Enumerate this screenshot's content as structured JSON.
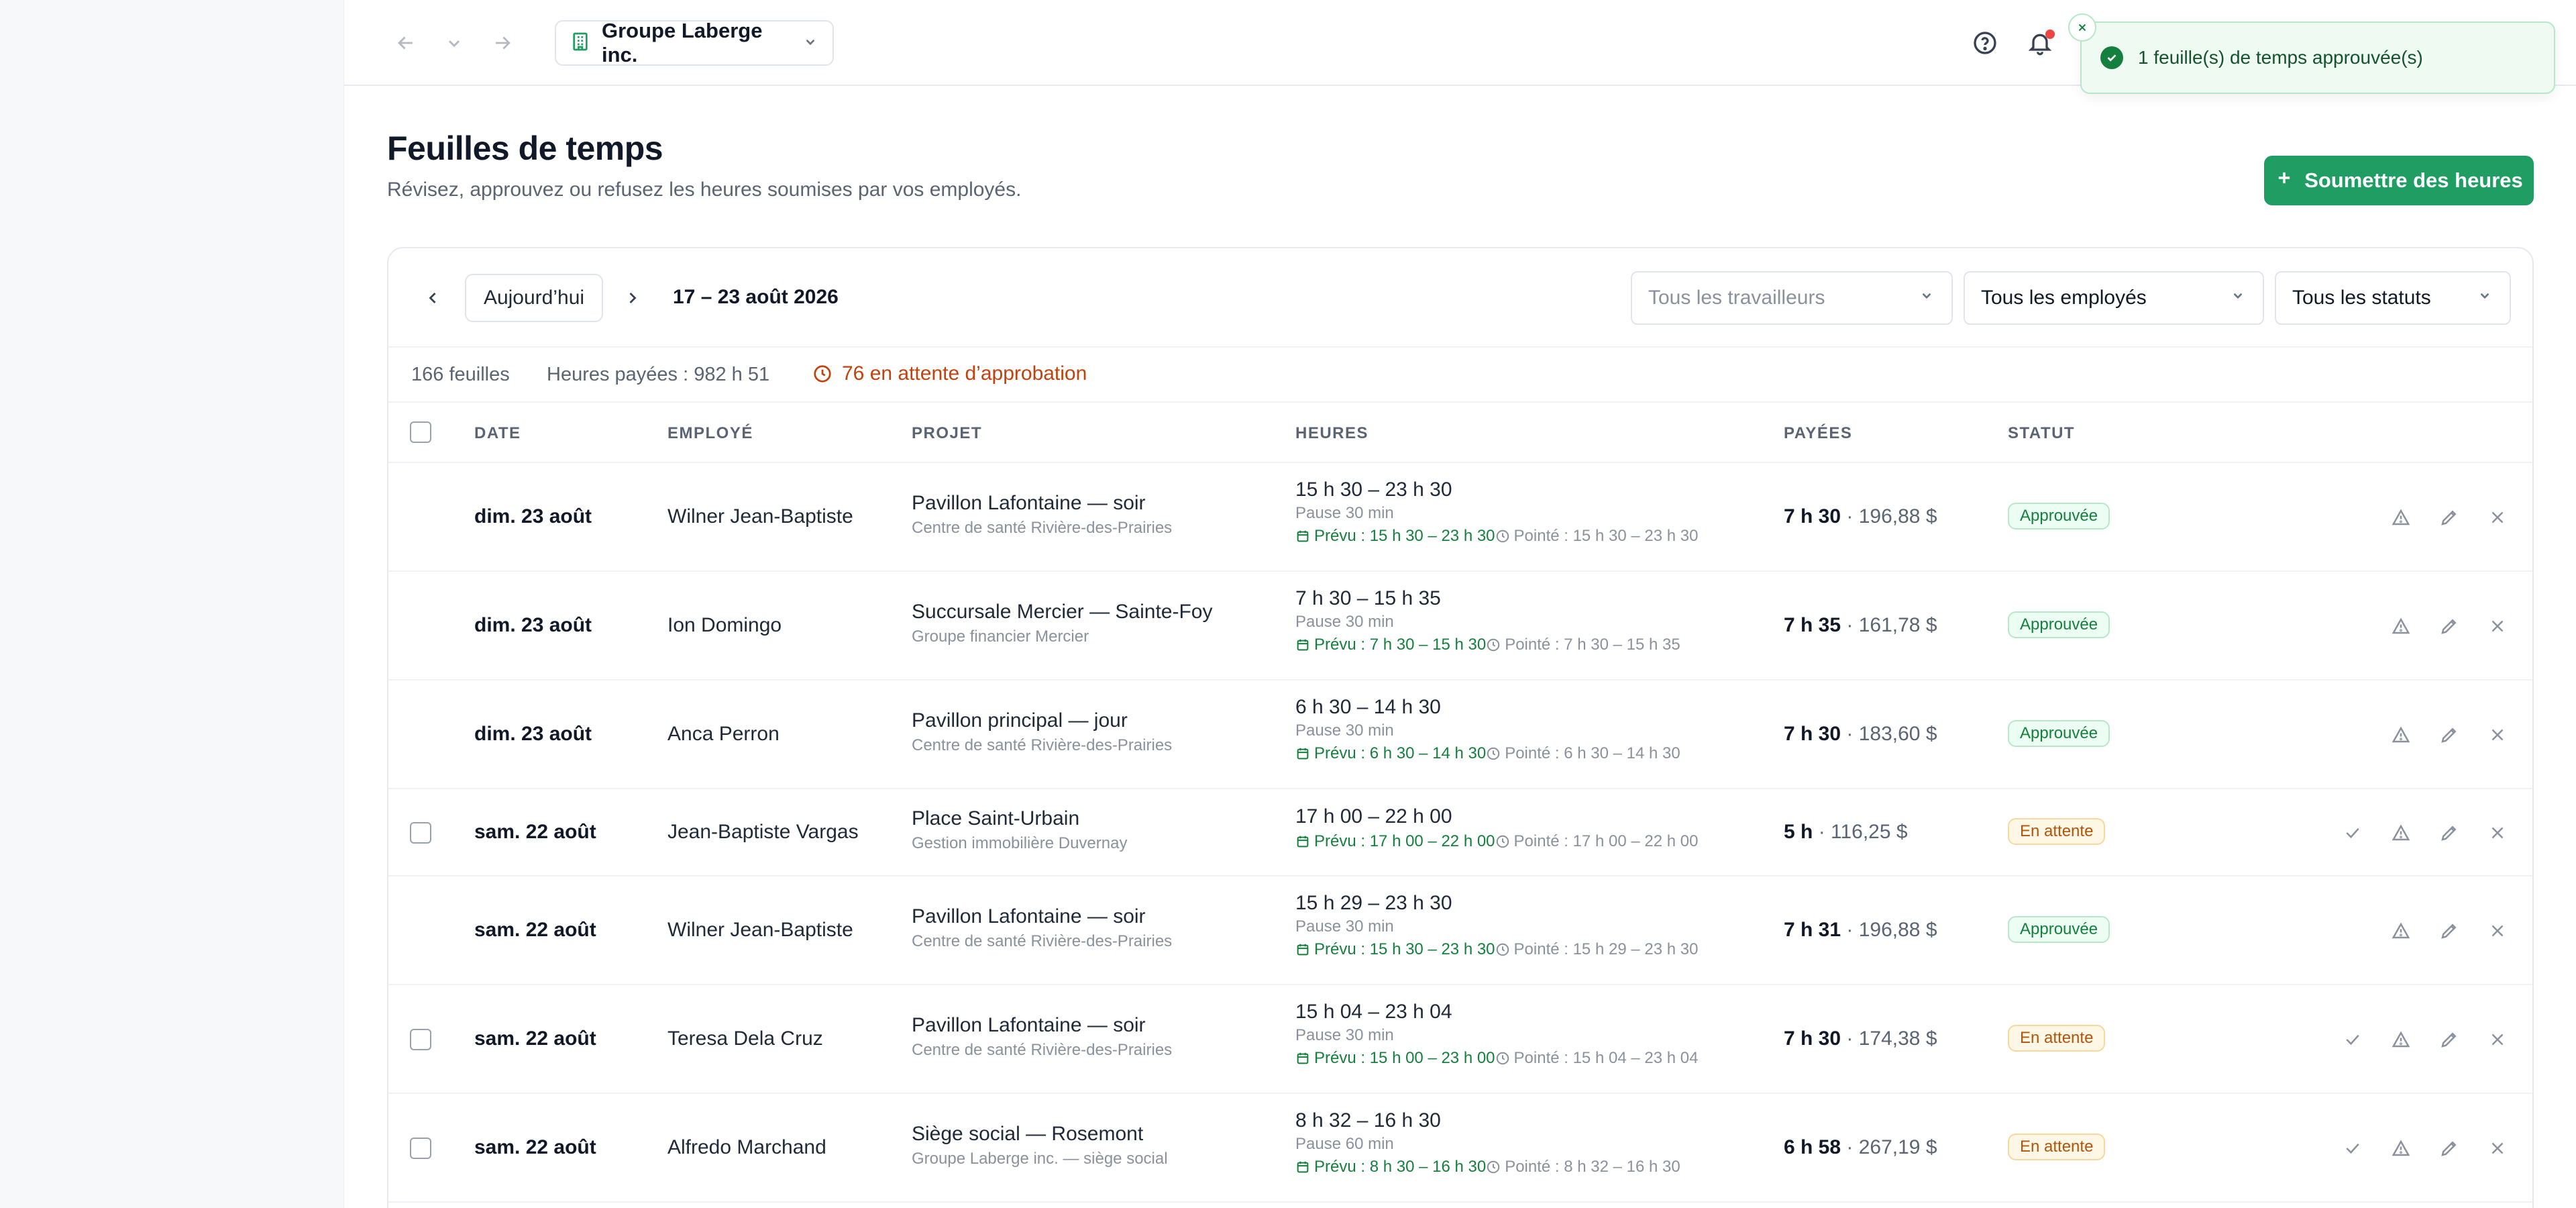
{
  "topbar": {
    "company": "Groupe Laberge inc."
  },
  "toast": {
    "message": "1 feuille(s) de temps approuvée(s)"
  },
  "header": {
    "title": "Feuilles de temps",
    "subtitle": "Révisez, approuvez ou refusez les heures soumises par vos employés.",
    "submit_label": "Soumettre des heures"
  },
  "toolbar": {
    "today_label": "Aujourd’hui",
    "week_range": "17 – 23 août 2026",
    "filters": {
      "workers_placeholder": "Tous les travailleurs",
      "employees_value": "Tous les employés",
      "status_value": "Tous les statuts"
    }
  },
  "summary": {
    "sheets": "166 feuilles",
    "paid_hours": "Heures payées : 982 h 51",
    "pending": "76 en attente d’approbation"
  },
  "table": {
    "headers": {
      "date": "DATE",
      "employee": "EMPLOYÉ",
      "project": "PROJET",
      "hours": "HEURES",
      "paid": "PAYÉES",
      "status": "STATUT"
    },
    "rows": [
      {
        "date": "dim. 23 août",
        "employee": "Wilner Jean-Baptiste",
        "project": "Pavillon Lafontaine — soir",
        "client": "Centre de santé Rivière-des-Prairies",
        "range": "15 h 30 – 23 h 30",
        "pause": "Pause 30 min",
        "planned": "Prévu : 15 h 30 – 23 h 30",
        "clocked": "Pointé : 15 h 30 – 23 h 30",
        "paid_hours": "7 h 30",
        "paid_amount": " · 196,88 $",
        "status": "Approuvée",
        "pending": false
      },
      {
        "date": "dim. 23 août",
        "employee": "Ion Domingo",
        "project": "Succursale Mercier — Sainte-Foy",
        "client": "Groupe financier Mercier",
        "range": "7 h 30 – 15 h 35",
        "pause": "Pause 30 min",
        "planned": "Prévu : 7 h 30 – 15 h 30",
        "clocked": "Pointé : 7 h 30 – 15 h 35",
        "paid_hours": "7 h 35",
        "paid_amount": " · 161,78 $",
        "status": "Approuvée",
        "pending": false
      },
      {
        "date": "dim. 23 août",
        "employee": "Anca Perron",
        "project": "Pavillon principal — jour",
        "client": "Centre de santé Rivière-des-Prairies",
        "range": "6 h 30 – 14 h 30",
        "pause": "Pause 30 min",
        "planned": "Prévu : 6 h 30 – 14 h 30",
        "clocked": "Pointé : 6 h 30 – 14 h 30",
        "paid_hours": "7 h 30",
        "paid_amount": " · 183,60 $",
        "status": "Approuvée",
        "pending": false
      },
      {
        "date": "sam. 22 août",
        "employee": "Jean-Baptiste Vargas",
        "project": "Place Saint-Urbain",
        "client": "Gestion immobilière Duvernay",
        "range": "17 h 00 – 22 h 00",
        "pause": "",
        "planned": "Prévu : 17 h 00 – 22 h 00",
        "clocked": "Pointé : 17 h 00 – 22 h 00",
        "paid_hours": "5 h",
        "paid_amount": " · 116,25 $",
        "status": "En attente",
        "pending": true
      },
      {
        "date": "sam. 22 août",
        "employee": "Wilner Jean-Baptiste",
        "project": "Pavillon Lafontaine — soir",
        "client": "Centre de santé Rivière-des-Prairies",
        "range": "15 h 29 – 23 h 30",
        "pause": "Pause 30 min",
        "planned": "Prévu : 15 h 30 – 23 h 30",
        "clocked": "Pointé : 15 h 29 – 23 h 30",
        "paid_hours": "7 h 31",
        "paid_amount": " · 196,88 $",
        "status": "Approuvée",
        "pending": false
      },
      {
        "date": "sam. 22 août",
        "employee": "Teresa Dela Cruz",
        "project": "Pavillon Lafontaine — soir",
        "client": "Centre de santé Rivière-des-Prairies",
        "range": "15 h 04 – 23 h 04",
        "pause": "Pause 30 min",
        "planned": "Prévu : 15 h 00 – 23 h 00",
        "clocked": "Pointé : 15 h 04 – 23 h 04",
        "paid_hours": "7 h 30",
        "paid_amount": " · 174,38 $",
        "status": "En attente",
        "pending": true
      },
      {
        "date": "sam. 22 août",
        "employee": "Alfredo Marchand",
        "project": "Siège social — Rosemont",
        "client": "Groupe Laberge inc. — siège social",
        "range": "8 h 32 – 16 h 30",
        "pause": "Pause 60 min",
        "planned": "Prévu : 8 h 30 – 16 h 30",
        "clocked": "Pointé : 8 h 32 – 16 h 30",
        "paid_hours": "6 h 58",
        "paid_amount": " · 267,19 $",
        "status": "En attente",
        "pending": true
      }
    ]
  }
}
